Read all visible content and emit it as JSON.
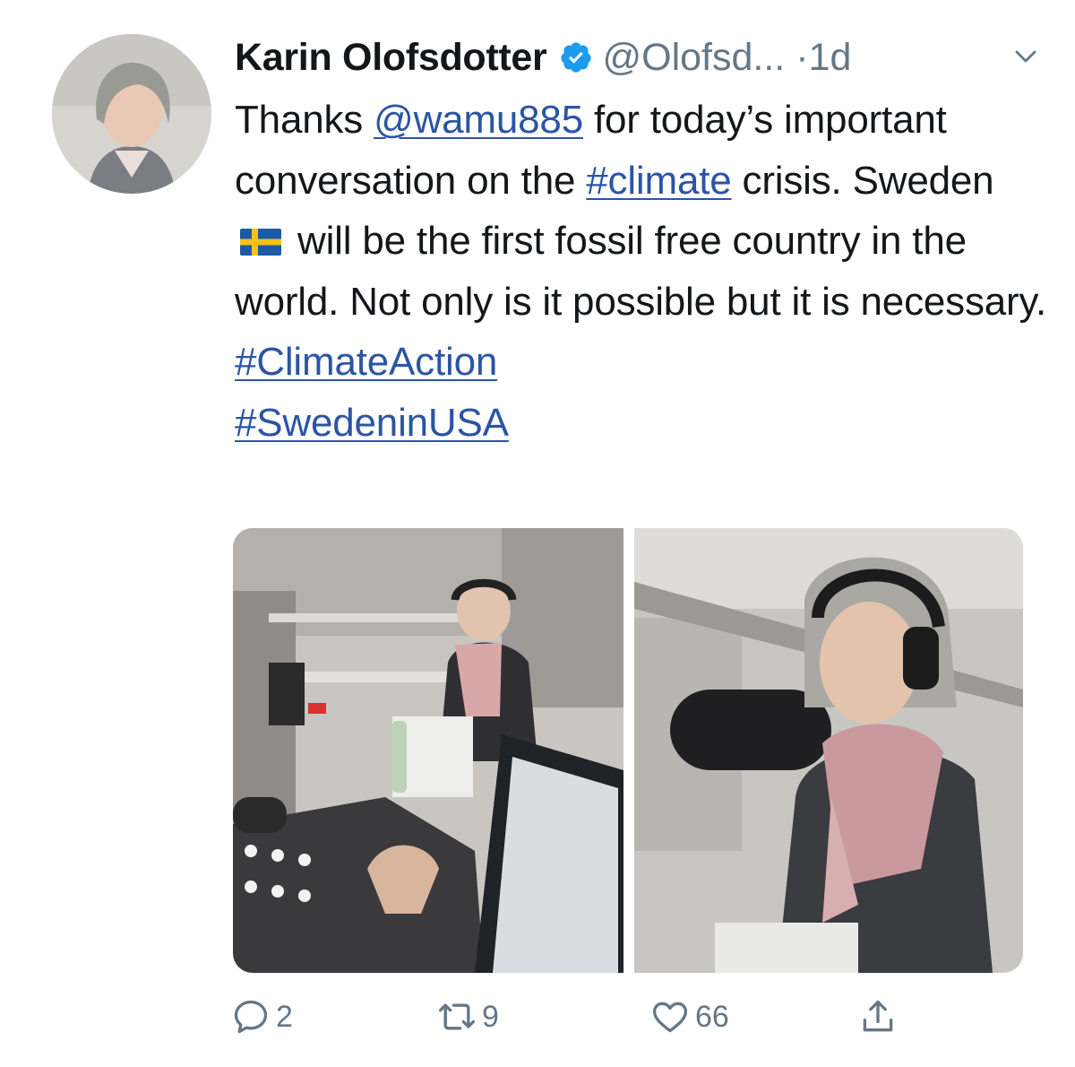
{
  "tweet": {
    "author_name": "Karin Olofsdotter",
    "author_handle": "@Olofsd...",
    "separator": "·",
    "time": "1d",
    "text": {
      "t1": "Thanks ",
      "mention": "@wamu885",
      "t2": " for today’s important conversation on the ",
      "hashtag1": "#climate",
      "t3": " crisis. Sweden ",
      "t4": " will be the first fossil free country in the world. Not only is it possible but it is necessary. ",
      "hashtag2": "#ClimateAction",
      "hashtag3": "#SwedeninUSA"
    },
    "icons": {
      "verified": "verified-badge-icon",
      "menu": "chevron-down-icon",
      "flag": "sweden-flag-icon"
    }
  },
  "actions": {
    "replies": "2",
    "retweets": "9",
    "likes": "66",
    "icons": [
      "reply-icon",
      "retweet-icon",
      "like-icon",
      "share-icon"
    ]
  },
  "colors": {
    "link": "#2a55a6",
    "muted": "#657786",
    "text": "#14171a",
    "verified": "#1d9bf0"
  }
}
